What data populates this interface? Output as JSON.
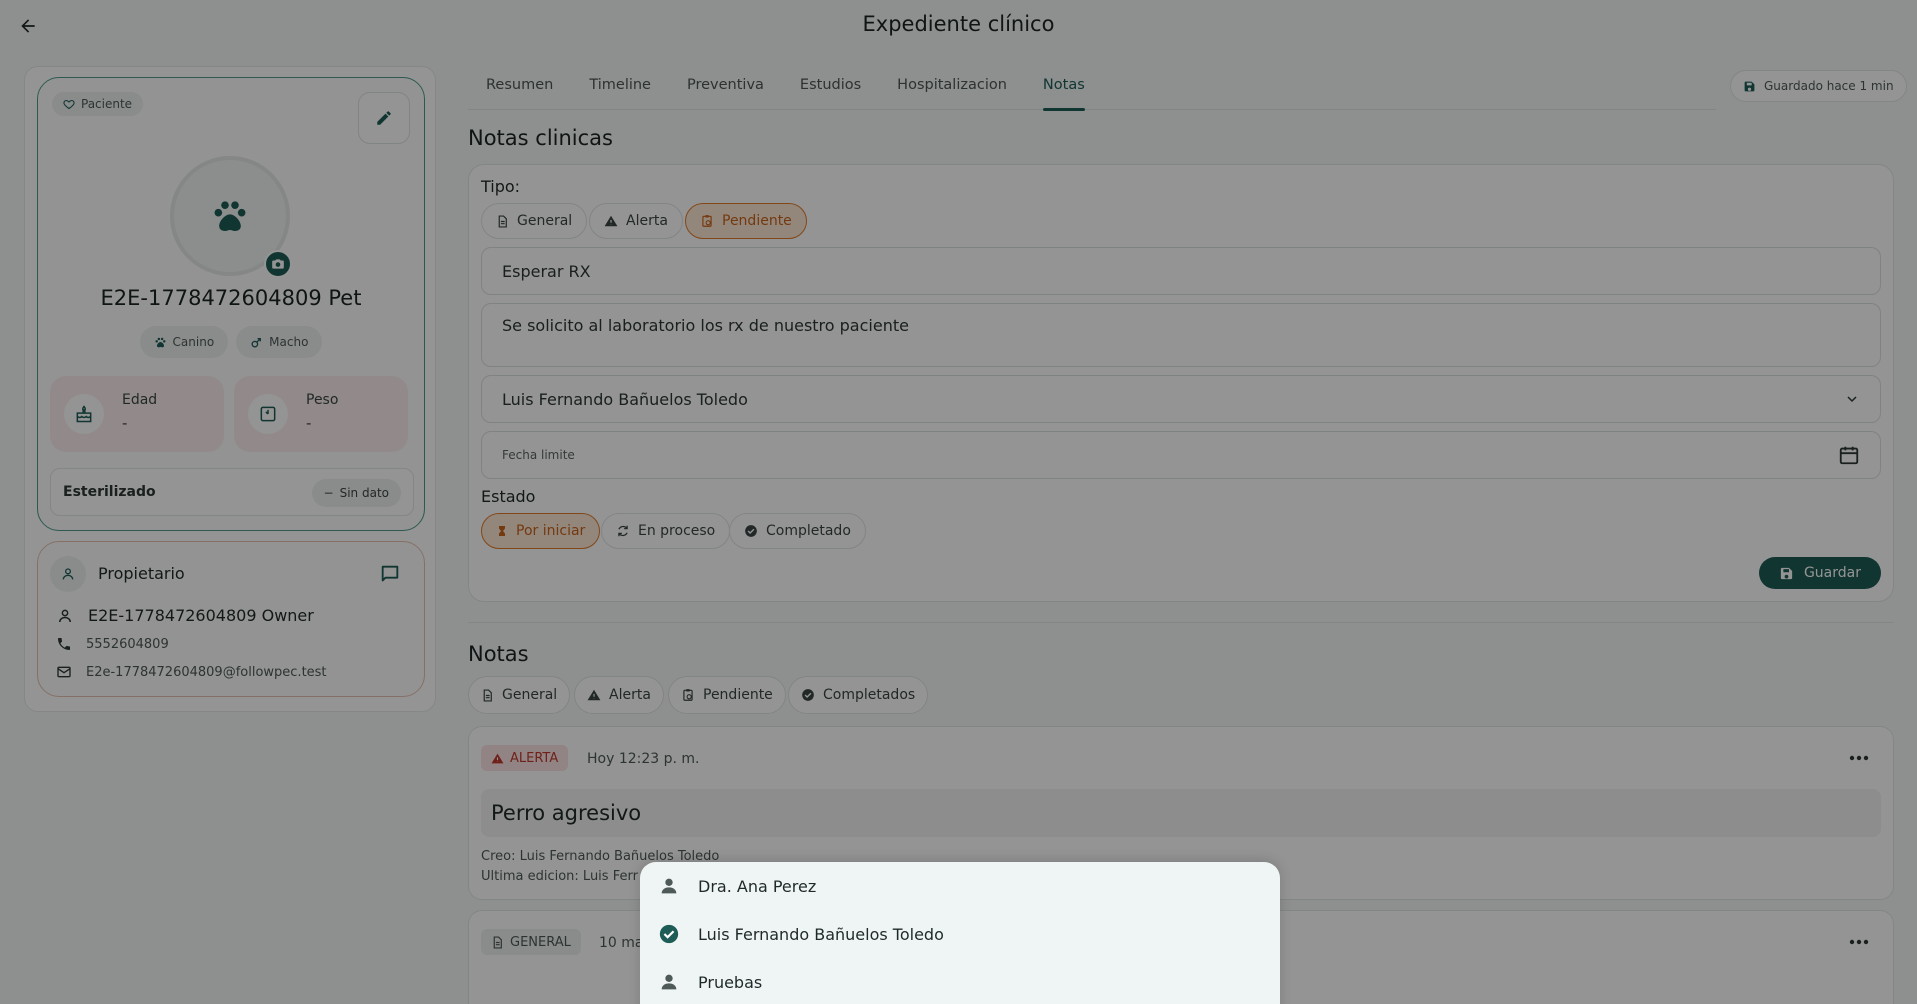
{
  "header": {
    "title": "Expediente clínico"
  },
  "patient": {
    "role_chip": "Paciente",
    "name": "E2E-1778472604809 Pet",
    "species": "Canino",
    "sex": "Macho",
    "age_label": "Edad",
    "age_value": "-",
    "weight_label": "Peso",
    "weight_value": "-",
    "sterilized_label": "Esterilizado",
    "sterilized_value": "Sin dato"
  },
  "owner": {
    "title": "Propietario",
    "name": "E2E-1778472604809 Owner",
    "phone": "5552604809",
    "email": "E2e-1778472604809@followpec.test"
  },
  "tabs": [
    {
      "label": "Resumen"
    },
    {
      "label": "Timeline"
    },
    {
      "label": "Preventiva"
    },
    {
      "label": "Estudios"
    },
    {
      "label": "Hospitalizacion"
    },
    {
      "label": "Notas",
      "active": true
    }
  ],
  "saved_status": "Guardado hace 1 min",
  "form": {
    "section_title": "Notas clinicas",
    "type_label": "Tipo:",
    "types": [
      "General",
      "Alerta",
      "Pendiente"
    ],
    "selected_type": "Pendiente",
    "title_value": "Esperar RX",
    "body_value": "Se solicito al laboratorio los rx de nuestro paciente",
    "assignee_value": "Luis Fernando Bañuelos Toledo",
    "deadline_placeholder": "Fecha limite",
    "state_label": "Estado",
    "states": [
      "Por iniciar",
      "En proceso",
      "Completado"
    ],
    "selected_state": "Por iniciar",
    "save_label": "Guardar"
  },
  "notes": {
    "section_title": "Notas",
    "filters": [
      "General",
      "Alerta",
      "Pendiente",
      "Completados"
    ],
    "items": [
      {
        "badge": "ALERTA",
        "time": "Hoy 12:23 p. m.",
        "title": "Perro agresivo",
        "created_by": "Creo: Luis Fernando Bañuelos Toledo",
        "edited_by": "Ultima edicion: Luis Ferr"
      },
      {
        "badge": "GENERAL",
        "time": "10 ma"
      }
    ]
  },
  "assignee_menu": {
    "options": [
      {
        "label": "Dra. Ana Perez",
        "selected": false
      },
      {
        "label": "Luis Fernando Bañuelos Toledo",
        "selected": true
      },
      {
        "label": "Pruebas",
        "selected": false
      }
    ]
  },
  "colors": {
    "primary": "#1e5d57",
    "pending": "#e07b2a",
    "alert": "#c0392b"
  }
}
